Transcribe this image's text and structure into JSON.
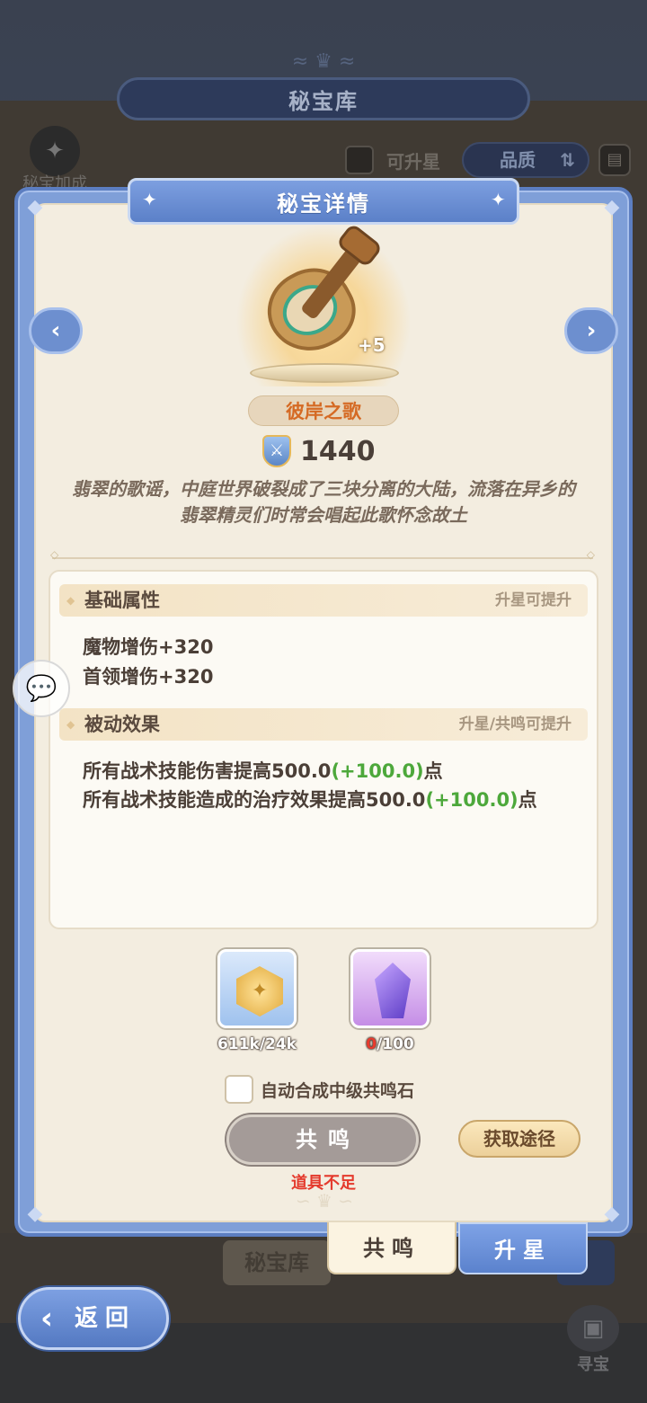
{
  "background": {
    "header_title": "秘宝库",
    "bonus_label": "秘宝加成",
    "upgradable_label": "可升星",
    "sort_label": "品质",
    "vault_tab": "秘宝库",
    "treasure_hunt_label": "寻宝"
  },
  "dialog": {
    "title": "秘宝详情",
    "item": {
      "name": "彼岸之歌",
      "level": "+5",
      "power": "1440",
      "description": "翡翠的歌谣，中庭世界破裂成了三块分离的大陆，流落在异乡的翡翠精灵们时常会唱起此歌怀念故土"
    },
    "base_attributes": {
      "title": "基础属性",
      "hint": "升星可提升",
      "lines": [
        "魔物增伤+320",
        "首领增伤+320"
      ]
    },
    "passive_effects": {
      "title": "被动效果",
      "hint": "升星/共鸣可提升",
      "lines": [
        {
          "prefix": "所有战术技能伤害提高500.0",
          "bonus": "(+100.0)",
          "suffix": "点"
        },
        {
          "prefix": "所有战术技能造成的治疗效果提高500.0",
          "bonus": "(+100.0)",
          "suffix": "点"
        }
      ]
    },
    "resources": [
      {
        "icon": "gold-coin-icon",
        "have": "611k",
        "need": "/24k"
      },
      {
        "icon": "resonance-stone-icon",
        "have": "0",
        "need": "/100"
      }
    ],
    "auto_synth_label": "自动合成中级共鸣石",
    "resonate_button": "共鸣",
    "get_source_button": "获取途径",
    "insufficient_text": "道具不足",
    "tabs": [
      "共鸣",
      "升星"
    ]
  },
  "back_button": "返回",
  "colors": {
    "accent_blue": "#6d8fcf",
    "name_orange": "#d56a24",
    "bonus_green": "#4da83b",
    "warning_red": "#e43a2d"
  }
}
